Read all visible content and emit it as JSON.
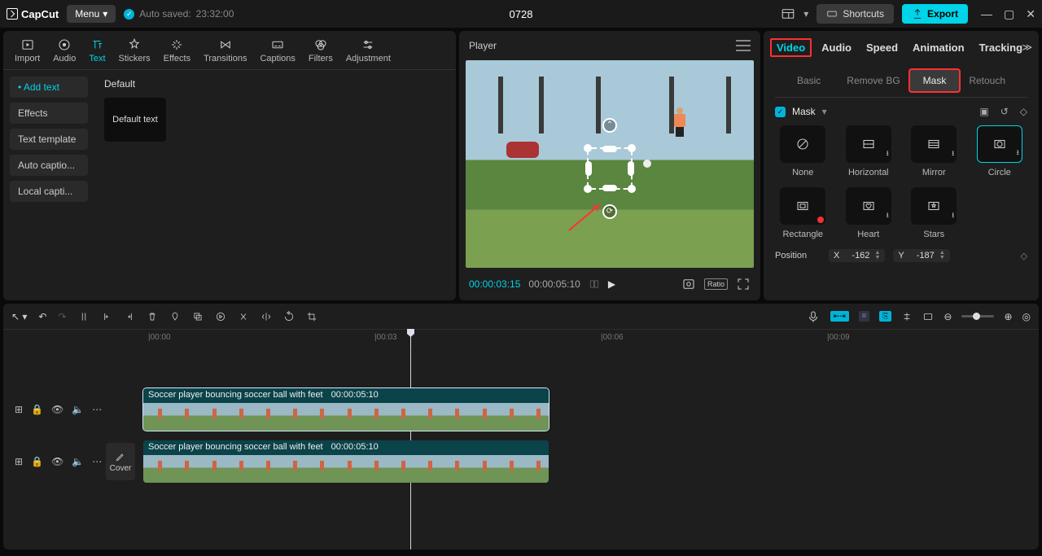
{
  "app": {
    "name": "CapCut",
    "menu": "Menu",
    "autosave_prefix": "Auto saved:",
    "autosave_time": "23:32:00",
    "doc_title": "0728"
  },
  "topright": {
    "shortcuts": "Shortcuts",
    "export": "Export"
  },
  "media_tabs": [
    "Import",
    "Audio",
    "Text",
    "Stickers",
    "Effects",
    "Transitions",
    "Captions",
    "Filters",
    "Adjustment"
  ],
  "text_sidebar": {
    "items": [
      "Add text",
      "Effects",
      "Text template",
      "Auto captio...",
      "Local capti..."
    ],
    "active": 0
  },
  "text_content": {
    "section": "Default",
    "default_text": "Default text"
  },
  "player": {
    "title": "Player",
    "tc_current": "00:00:03:15",
    "tc_total": "00:00:05:10",
    "ratio": "Ratio"
  },
  "inspector": {
    "tabs": [
      "Video",
      "Audio",
      "Speed",
      "Animation",
      "Tracking"
    ],
    "active_tab": 0,
    "subtabs": [
      "Basic",
      "Remove BG",
      "Mask",
      "Retouch"
    ],
    "active_subtab": 2,
    "mask_label": "Mask",
    "masks": [
      "None",
      "Horizontal",
      "Mirror",
      "Circle",
      "Rectangle",
      "Heart",
      "Stars"
    ],
    "selected_mask": 3,
    "position_label": "Position",
    "pos_x_label": "X",
    "pos_x": "-162",
    "pos_y_label": "Y",
    "pos_y": "-187"
  },
  "timeline": {
    "ruler": [
      "|00:00",
      "|00:03",
      "|00:06",
      "|00:09"
    ],
    "clip_name": "Soccer player bouncing soccer ball with feet",
    "clip_dur": "00:00:05:10",
    "cover": "Cover"
  }
}
